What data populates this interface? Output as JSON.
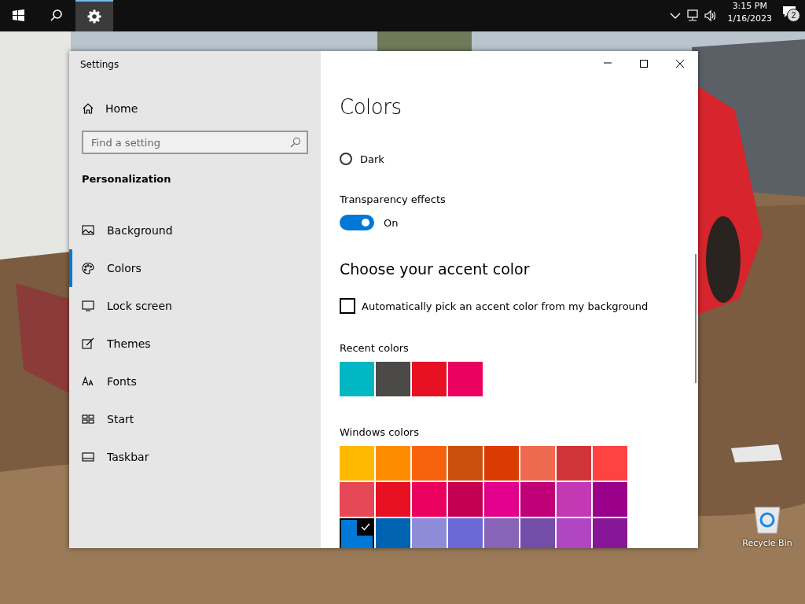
{
  "taskbar": {
    "apps": [
      {
        "kind": "start",
        "active": false
      },
      {
        "kind": "search",
        "active": false
      },
      {
        "kind": "settings",
        "active": true
      }
    ],
    "clock": {
      "time": "3:15 PM",
      "date": "1/16/2023"
    },
    "notifications": {
      "count": "2"
    }
  },
  "desktop": {
    "icons": [
      {
        "label": "Recycle Bin"
      }
    ]
  },
  "window": {
    "title": "Settings",
    "sidebar": {
      "home": "Home",
      "search": {
        "placeholder": "Find a setting"
      },
      "section": "Personalization",
      "items": [
        {
          "label": "Background",
          "selected": false
        },
        {
          "label": "Colors",
          "kind": "palette",
          "selected": true
        },
        {
          "label": "Lock screen",
          "kind": "lock",
          "selected": false
        },
        {
          "label": "Themes",
          "kind": "brush",
          "selected": false
        },
        {
          "label": "Fonts",
          "kind": "font",
          "selected": false
        },
        {
          "label": "Start",
          "kind": "start",
          "selected": false
        },
        {
          "label": "Taskbar",
          "kind": "taskbar",
          "selected": false
        }
      ]
    },
    "page": {
      "title": "Colors",
      "mode_options": [
        {
          "label": "Dark",
          "selected": false
        }
      ],
      "transparency": {
        "label": "Transparency effects",
        "on": true,
        "state": "On"
      },
      "accent_heading": "Choose your accent color",
      "auto_pick": {
        "label": "Automatically pick an accent color from my background",
        "checked": false
      },
      "recent": {
        "label": "Recent colors",
        "swatches": [
          {
            "color": "#00b7c3"
          },
          {
            "color": "#4c4a48"
          },
          {
            "color": "#e81123"
          },
          {
            "color": "#ea005e"
          }
        ]
      },
      "windows_colors": {
        "label": "Windows colors",
        "swatches": [
          {
            "color": "#ffb900",
            "selected": false
          },
          {
            "color": "#ff8c00",
            "selected": false
          },
          {
            "color": "#f7630c",
            "selected": false
          },
          {
            "color": "#ca5010",
            "selected": false
          },
          {
            "color": "#da3b01",
            "selected": false
          },
          {
            "color": "#ef6950",
            "selected": false
          },
          {
            "color": "#d13438",
            "selected": false
          },
          {
            "color": "#ff4343",
            "selected": false
          },
          {
            "color": "#e74856",
            "selected": false
          },
          {
            "color": "#e81123",
            "selected": false
          },
          {
            "color": "#ea005e",
            "selected": false
          },
          {
            "color": "#c30052",
            "selected": false
          },
          {
            "color": "#e3008c",
            "selected": false
          },
          {
            "color": "#bf0077",
            "selected": false
          },
          {
            "color": "#c239b3",
            "selected": false
          },
          {
            "color": "#9a0089",
            "selected": false
          },
          {
            "color": "#0078d7",
            "selected": true
          },
          {
            "color": "#0063b1",
            "selected": false
          },
          {
            "color": "#8e8cd8",
            "selected": false
          },
          {
            "color": "#6b69d6",
            "selected": false
          },
          {
            "color": "#8764b8",
            "selected": false
          },
          {
            "color": "#744da9",
            "selected": false
          },
          {
            "color": "#b146c2",
            "selected": false
          },
          {
            "color": "#881798",
            "selected": false
          }
        ]
      }
    }
  }
}
